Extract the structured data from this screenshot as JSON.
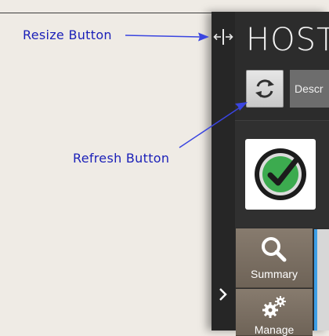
{
  "host_panel": {
    "title": "HOST",
    "description_button_label": "Descr",
    "status_icon": "check-circle-icon",
    "status_color": "#3cab4f",
    "tabs": [
      {
        "label": "Summary",
        "icon": "search-icon"
      },
      {
        "label": "Manage",
        "icon": "gears-icon"
      }
    ],
    "active_tab_edge_color": "#3d9ee6"
  },
  "annotations": {
    "resize_button": "Resize Button",
    "refresh_button": "Refresh Button",
    "color": "#1a1fb8"
  },
  "icons": {
    "resize": "resize-horizontal-icon",
    "refresh": "refresh-icon",
    "expand": "chevron-right-icon"
  }
}
